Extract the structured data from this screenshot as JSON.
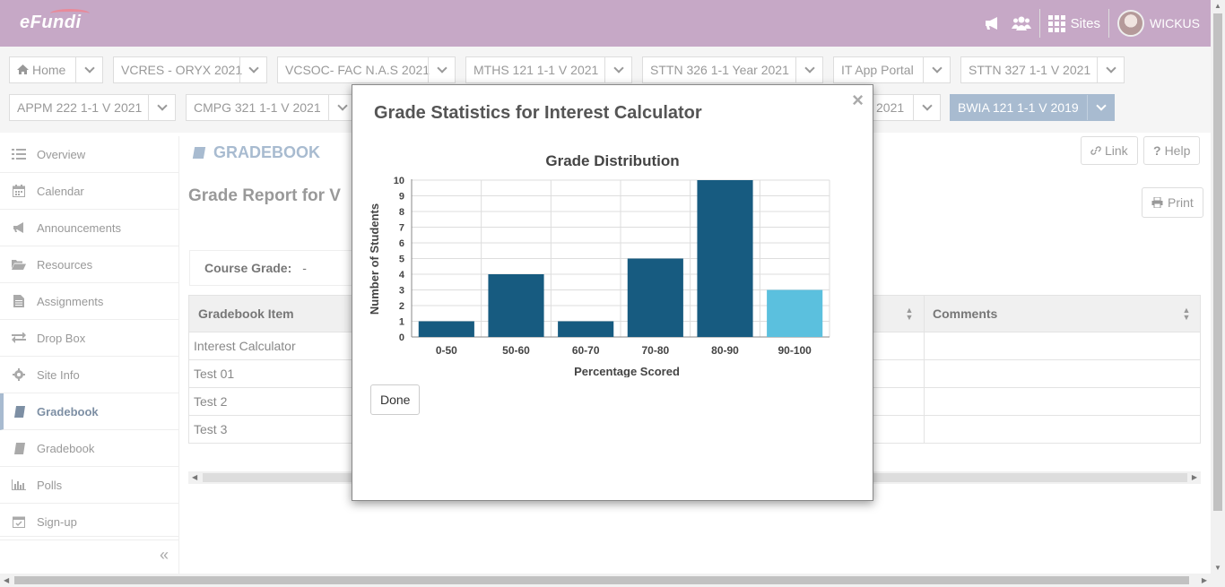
{
  "header": {
    "logo": "eFundi",
    "sites_label": "Sites",
    "user_name": "WICKUS"
  },
  "site_tabs": [
    {
      "label": "Home"
    },
    {
      "label": "VCRES - ORYX 2021"
    },
    {
      "label": "VCSOC- FAC N.A.S 2021"
    },
    {
      "label": "MTHS 121 1-1 V 2021"
    },
    {
      "label": "STTN 326 1-1 Year 2021"
    },
    {
      "label": "IT App Portal"
    },
    {
      "label": "STTN 327 1-1 V 2021"
    },
    {
      "label": "APPM 222 1-1 V 2021"
    },
    {
      "label": "CMPG 321 1-1 V 2021"
    },
    {
      "label": "2021"
    },
    {
      "label": "BWIA 121 1-1 V 2019"
    }
  ],
  "sidebar": {
    "items": [
      {
        "label": "Overview"
      },
      {
        "label": "Calendar"
      },
      {
        "label": "Announcements"
      },
      {
        "label": "Resources"
      },
      {
        "label": "Assignments"
      },
      {
        "label": "Drop Box"
      },
      {
        "label": "Site Info"
      },
      {
        "label": "Gradebook"
      },
      {
        "label": "Gradebook"
      },
      {
        "label": "Polls"
      },
      {
        "label": "Sign-up"
      }
    ],
    "collapse_label": "«"
  },
  "main": {
    "tool_title": "GRADEBOOK",
    "link_label": "Link",
    "help_label": "Help",
    "print_label": "Print",
    "report_title": "Grade Report for V",
    "course_grade_label": "Course Grade:",
    "course_grade_value": "-",
    "table": {
      "col_item": "Gradebook Item",
      "col_comments": "Comments",
      "rows": [
        "Interest Calculator",
        "Test 01",
        "Test 2",
        "Test 3"
      ]
    }
  },
  "modal": {
    "title": "Grade Statistics for Interest Calculator",
    "close_label": "×",
    "done_label": "Done"
  },
  "colors": {
    "header_bg": "#c6a8c6",
    "bar_dark": "#175b80",
    "bar_highlight": "#5bc0de",
    "active_tab": "#a8bbd0"
  },
  "chart_data": {
    "type": "bar",
    "title": "Grade Distribution",
    "xlabel": "Percentage Scored",
    "ylabel": "Number of Students",
    "categories": [
      "0-50",
      "50-60",
      "60-70",
      "70-80",
      "80-90",
      "90-100"
    ],
    "values": [
      1,
      4,
      1,
      5,
      10,
      3
    ],
    "highlight_index": 5,
    "ylim": [
      0,
      10
    ],
    "yticks": [
      0,
      1,
      2,
      3,
      4,
      5,
      6,
      7,
      8,
      9,
      10
    ],
    "grid": true
  }
}
